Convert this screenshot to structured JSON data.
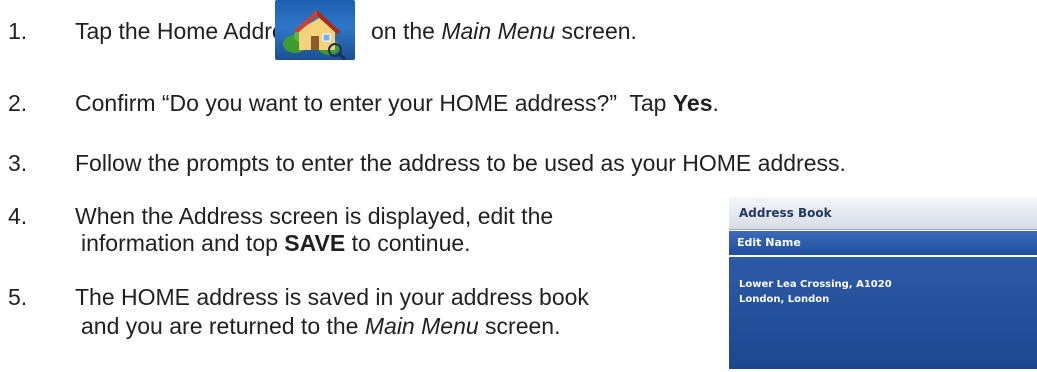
{
  "steps": [
    {
      "num": "1.",
      "before_icon": "Tap the Home Address icon",
      "after_icon_pre": "on the ",
      "after_icon_italic": "Main Menu",
      "after_icon_post": " screen.",
      "icon": "home-address-icon"
    },
    {
      "num": "2.",
      "text": "Confirm “Do you want to enter your HOME address?”  Tap ",
      "bold": "Yes",
      "after": "."
    },
    {
      "num": "3.",
      "text": "Follow the prompts to enter the address to be used as your HOME address."
    },
    {
      "num": "4.",
      "line1": "When the Address screen is displayed, edit the",
      "line2_pre": "information and top ",
      "line2_bold": "SAVE",
      "line2_post": " to continue."
    },
    {
      "num": "5.",
      "line1": "The HOME address is saved in your address book",
      "line2_pre": "and you are returned to the ",
      "line2_italic": "Main Menu",
      "line2_post": " screen."
    }
  ],
  "address_book": {
    "title": "Address Book",
    "bar_label": "Edit Name",
    "line1": "Lower Lea Crossing, A1020",
    "line2": "London, London"
  },
  "colors": {
    "text": "#231f20",
    "screen_blue": "#1f4f9e",
    "icon_blue": "#2f76c9"
  }
}
